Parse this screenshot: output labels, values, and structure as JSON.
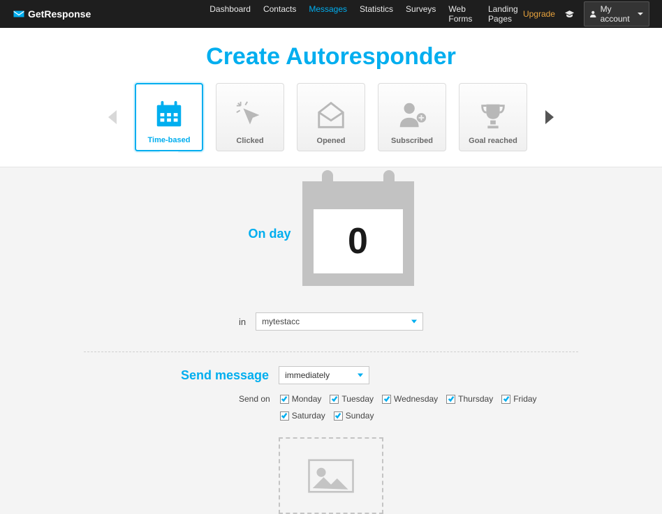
{
  "brand": "GetResponse",
  "nav": {
    "items": [
      "Dashboard",
      "Contacts",
      "Messages",
      "Statistics",
      "Surveys",
      "Web Forms",
      "Landing Pages"
    ],
    "active_index": 2,
    "upgrade": "Upgrade",
    "account": "My account"
  },
  "title": "Create Autoresponder",
  "cards": {
    "items": [
      {
        "key": "time-based",
        "label": "Time-based"
      },
      {
        "key": "clicked",
        "label": "Clicked"
      },
      {
        "key": "opened",
        "label": "Opened"
      },
      {
        "key": "subscribed",
        "label": "Subscribed"
      },
      {
        "key": "goal-reached",
        "label": "Goal reached"
      }
    ],
    "active_index": 0
  },
  "form": {
    "on_day_label": "On day",
    "day_value": "0",
    "in_label": "in",
    "campaign_value": "mytestacc",
    "send_message_label": "Send message",
    "send_when_value": "immediately",
    "send_on_label": "Send on",
    "days": [
      {
        "label": "Monday",
        "checked": true
      },
      {
        "label": "Tuesday",
        "checked": true
      },
      {
        "label": "Wednesday",
        "checked": true
      },
      {
        "label": "Thursday",
        "checked": true
      },
      {
        "label": "Friday",
        "checked": true
      },
      {
        "label": "Saturday",
        "checked": true
      },
      {
        "label": "Sunday",
        "checked": true
      }
    ]
  }
}
